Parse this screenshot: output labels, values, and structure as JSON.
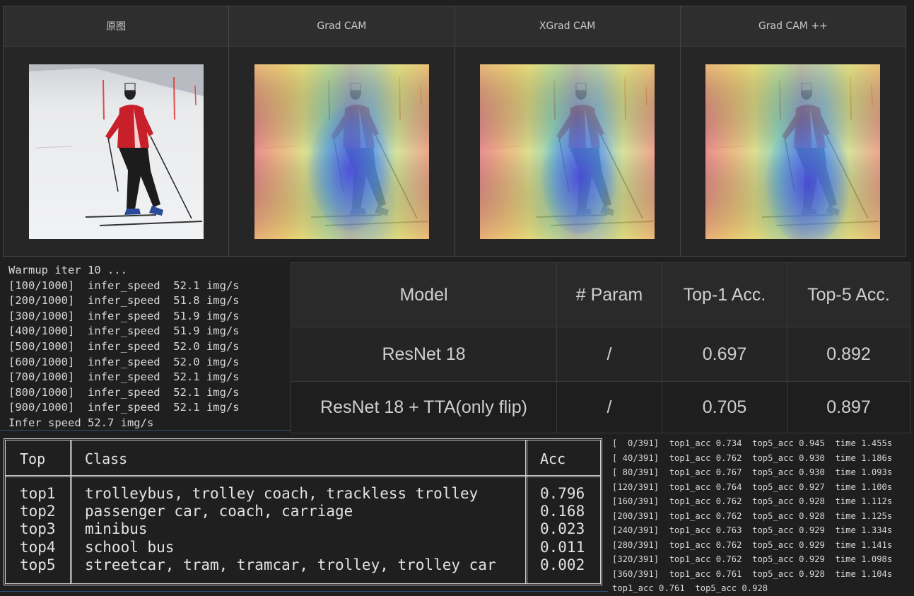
{
  "cam_panel": {
    "columns": [
      {
        "title": "原图",
        "icon": "skier-photo"
      },
      {
        "title": "Grad CAM",
        "icon": "gradcam-heatmap"
      },
      {
        "title": "XGrad CAM",
        "icon": "xgradcam-heatmap"
      },
      {
        "title": "Grad CAM ++",
        "icon": "gradcampp-heatmap"
      }
    ]
  },
  "warmup_log": {
    "header": "Warmup iter 10 ...",
    "lines": [
      "[100/1000]  infer_speed  52.1 img/s",
      "[200/1000]  infer_speed  51.8 img/s",
      "[300/1000]  infer_speed  51.9 img/s",
      "[400/1000]  infer_speed  51.9 img/s",
      "[500/1000]  infer_speed  52.0 img/s",
      "[600/1000]  infer_speed  52.0 img/s",
      "[700/1000]  infer_speed  52.1 img/s",
      "[800/1000]  infer_speed  52.1 img/s",
      "[900/1000]  infer_speed  52.1 img/s"
    ],
    "footer": "Infer speed 52.7 img/s"
  },
  "model_table": {
    "headers": [
      "Model",
      "# Param",
      "Top-1 Acc.",
      "Top-5 Acc."
    ],
    "rows": [
      [
        "ResNet 18",
        "/",
        "0.697",
        "0.892"
      ],
      [
        "ResNet 18 + TTA(only flip)",
        "/",
        "0.705",
        "0.897"
      ]
    ]
  },
  "top_table": {
    "headers": [
      "Top",
      "Class",
      "Acc"
    ],
    "rows": [
      [
        "top1",
        "trolleybus, trolley coach, trackless trolley",
        "0.796"
      ],
      [
        "top2",
        "passenger car, coach, carriage",
        "0.168"
      ],
      [
        "top3",
        "minibus",
        "0.023"
      ],
      [
        "top4",
        "school bus",
        "0.011"
      ],
      [
        "top5",
        "streetcar, tram, tramcar, trolley, trolley car",
        "0.002"
      ]
    ]
  },
  "eval_log": {
    "lines": [
      "[  0/391]  top1_acc 0.734  top5_acc 0.945  time 1.455s",
      "[ 40/391]  top1_acc 0.762  top5_acc 0.930  time 1.186s",
      "[ 80/391]  top1_acc 0.767  top5_acc 0.930  time 1.093s",
      "[120/391]  top1_acc 0.764  top5_acc 0.927  time 1.100s",
      "[160/391]  top1_acc 0.762  top5_acc 0.928  time 1.112s",
      "[200/391]  top1_acc 0.762  top5_acc 0.928  time 1.125s",
      "[240/391]  top1_acc 0.763  top5_acc 0.929  time 1.334s",
      "[280/391]  top1_acc 0.762  top5_acc 0.929  time 1.141s",
      "[320/391]  top1_acc 0.762  top5_acc 0.929  time 1.098s",
      "[360/391]  top1_acc 0.761  top5_acc 0.928  time 1.104s"
    ],
    "summary": "top1_acc 0.761  top5_acc 0.928"
  },
  "colors": {
    "background": "#1f1f1f",
    "panel": "#262626",
    "text": "#d8d8d8",
    "accent_line": "#2b4f7a",
    "skier_jacket": "#c8202a"
  }
}
